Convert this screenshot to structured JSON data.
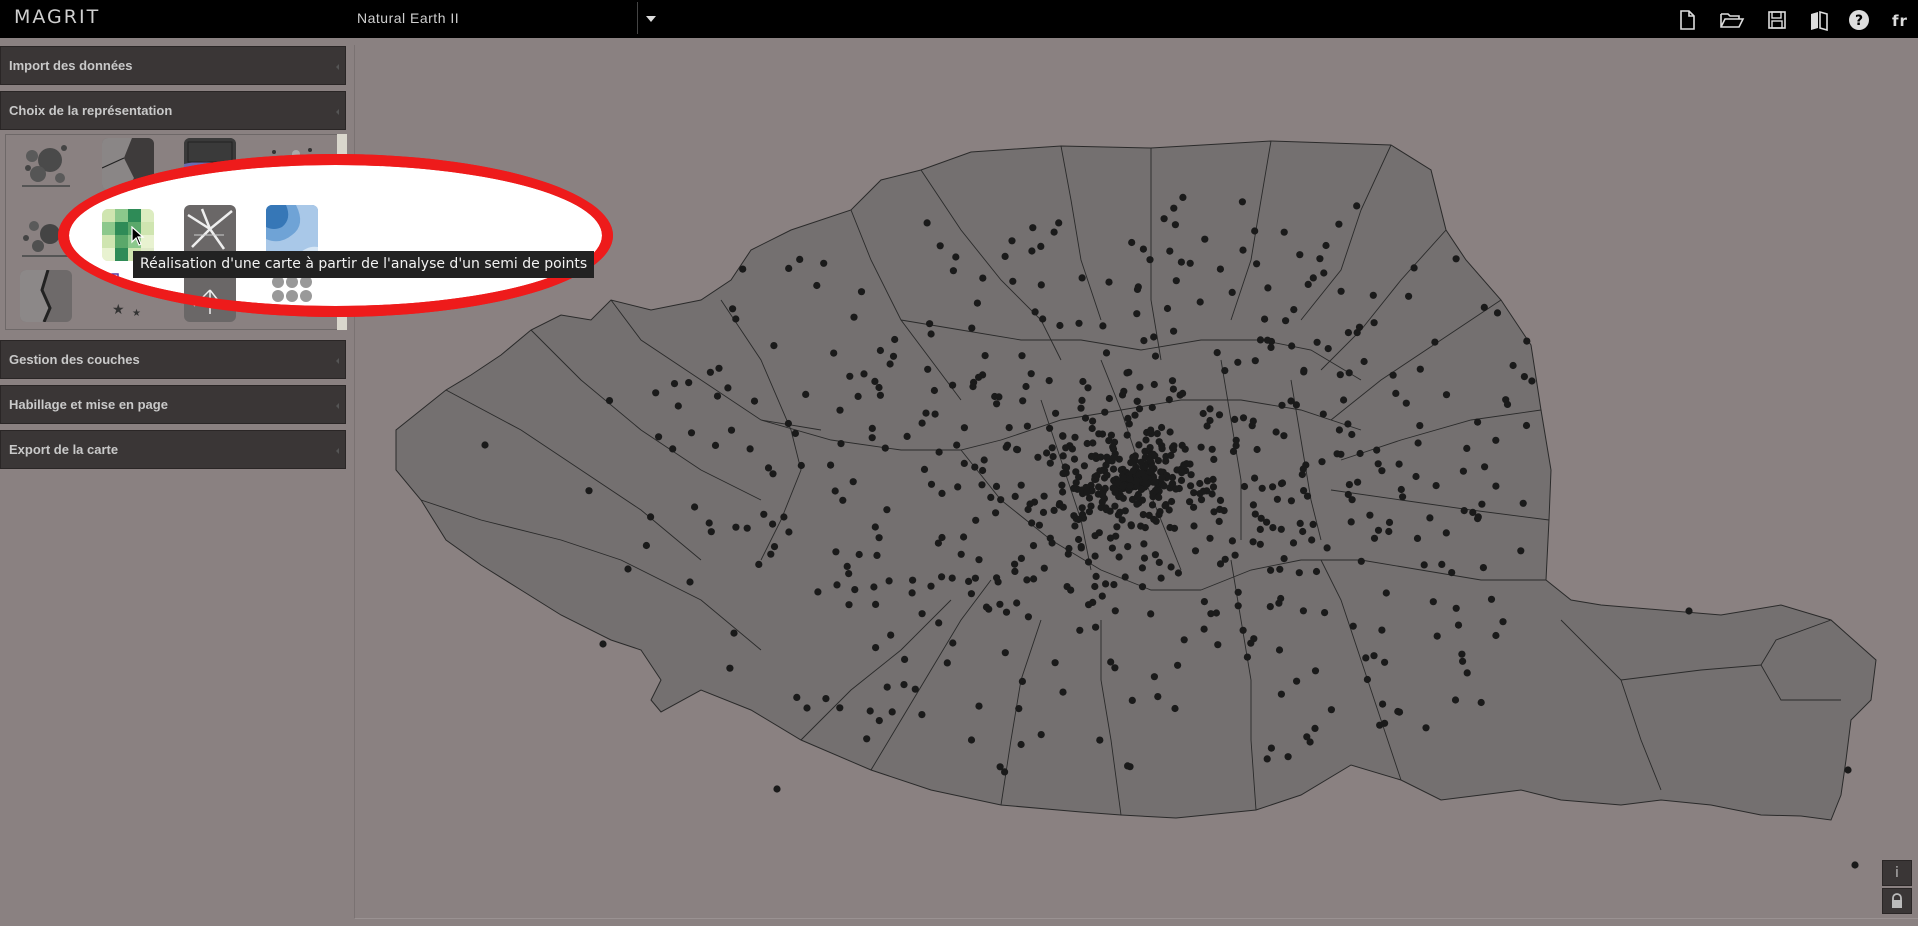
{
  "app": {
    "logo": "MAGRIT"
  },
  "header": {
    "projection": "Natural Earth II",
    "icons": [
      "new-file-icon",
      "open-folder-icon",
      "save-icon",
      "book-icon",
      "help-icon"
    ],
    "language": "fr"
  },
  "sidebar": {
    "sections": [
      {
        "label": "Import des données"
      },
      {
        "label": "Choix de la représentation"
      },
      {
        "label": "Gestion des couches"
      },
      {
        "label": "Habillage et mise en page"
      },
      {
        "label": "Export de la carte"
      }
    ],
    "representation_icons": [
      "proportional-symbols-icon",
      "typology-icon",
      "choropleth-icon",
      "stewart-icon",
      "proportional-symbols-choro-icon",
      "grid-icon",
      "flows-icon",
      "smoothed-icon",
      "discontinuities-icon",
      "typo-symbols-icon",
      "links-icon",
      "cartogram-icon"
    ]
  },
  "tooltip": "Réalisation d'une carte à partir de l'analyse d'un semi de points",
  "map": {
    "fill": "#747070",
    "outline": "#2a2a2a",
    "point_color": "#1a1a1a"
  },
  "corner_buttons": {
    "info": "i",
    "lock": "lock-icon"
  },
  "colors": {
    "highlight": "#ee1b1b",
    "topbar": "#000000",
    "panel": "#3a3636"
  }
}
